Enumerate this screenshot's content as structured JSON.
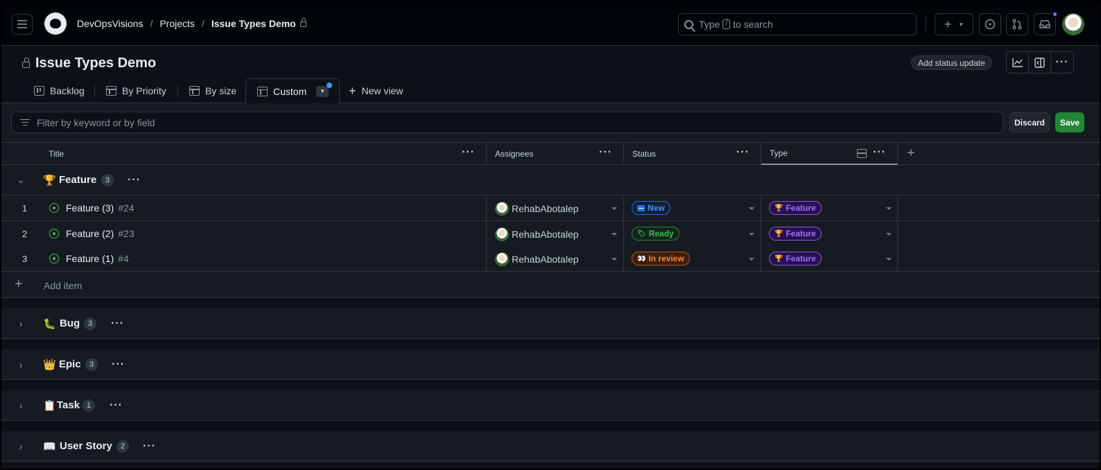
{
  "header": {
    "breadcrumbs": [
      "DevOpsVisions",
      "Projects",
      "Issue Types Demo"
    ],
    "search_before": "Type",
    "search_key": "/",
    "search_after": "to search"
  },
  "project": {
    "title": "Issue Types Demo",
    "status_update_label": "Add status update"
  },
  "tabs": [
    {
      "label": "Backlog"
    },
    {
      "label": "By Priority"
    },
    {
      "label": "By size"
    },
    {
      "label": "Custom"
    }
  ],
  "new_view_label": "New view",
  "filter": {
    "placeholder": "Filter by keyword or by field",
    "discard_label": "Discard",
    "save_label": "Save"
  },
  "columns": [
    "Title",
    "Assignees",
    "Status",
    "Type"
  ],
  "groups": [
    {
      "emoji": "🏆",
      "name": "Feature",
      "count": "3",
      "expanded": true
    },
    {
      "emoji": "🐛",
      "name": "Bug",
      "count": "3",
      "expanded": false
    },
    {
      "emoji": "👑",
      "name": "Epic",
      "count": "3",
      "expanded": false
    },
    {
      "emoji": "📋",
      "name": "Task",
      "count": "1",
      "expanded": false
    },
    {
      "emoji": "📖",
      "name": "User Story",
      "count": "2",
      "expanded": false
    }
  ],
  "rows": [
    {
      "num": "1",
      "title": "Feature (3)",
      "issue": "#24",
      "assignee": "RehabAbotalep",
      "status": "New",
      "status_emoji": "",
      "type": "Feature",
      "type_emoji": "🏆"
    },
    {
      "num": "2",
      "title": "Feature (2)",
      "issue": "#23",
      "assignee": "RehabAbotalep",
      "status": "Ready",
      "status_emoji": "🏷",
      "type": "Feature",
      "type_emoji": "🏆"
    },
    {
      "num": "3",
      "title": "Feature (1)",
      "issue": "#4",
      "assignee": "RehabAbotalep",
      "status": "In review",
      "status_emoji": "👀",
      "type": "Feature",
      "type_emoji": "🏆"
    }
  ],
  "add_item_label": "Add item",
  "colors": {
    "accent": "#4493f8",
    "save": "#238636",
    "open_issue": "#3fb950",
    "feature": "#a371f7"
  }
}
